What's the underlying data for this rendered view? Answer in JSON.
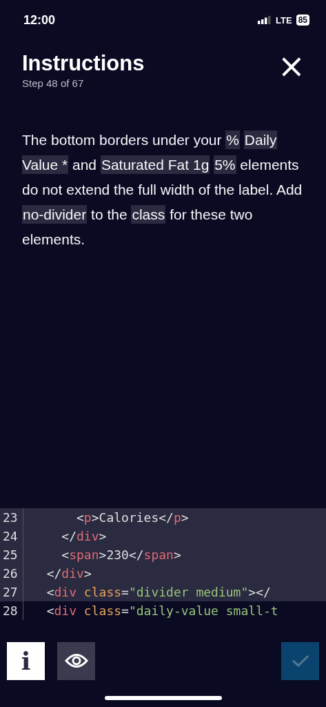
{
  "status_bar": {
    "time": "12:00",
    "network": "LTE",
    "battery": "85"
  },
  "header": {
    "title": "Instructions",
    "subtitle": "Step 48 of 67",
    "close": "×"
  },
  "instruction": [
    {
      "kind": "text",
      "text": "The bottom borders under your "
    },
    {
      "kind": "code",
      "text": "%"
    },
    {
      "kind": "code",
      "text": "Daily Value *"
    },
    {
      "kind": "text",
      "text": " and "
    },
    {
      "kind": "code",
      "text": "Saturated Fat 1g"
    },
    {
      "kind": "code",
      "text": "5%"
    },
    {
      "kind": "text",
      "text": " elements do not extend the full width of the label. Add "
    },
    {
      "kind": "code",
      "text": "no-divider"
    },
    {
      "kind": "text",
      "text": " to the "
    },
    {
      "kind": "code",
      "text": "class"
    },
    {
      "kind": "text",
      "text": " for these two elements."
    }
  ],
  "editor": {
    "lines": [
      {
        "number": "23",
        "selected": true,
        "tokens": [
          {
            "kind": "plain",
            "text": "      <"
          },
          {
            "kind": "tag",
            "text": "p"
          },
          {
            "kind": "plain",
            "text": ">Calories</"
          },
          {
            "kind": "tag",
            "text": "p"
          },
          {
            "kind": "plain",
            "text": ">"
          }
        ]
      },
      {
        "number": "24",
        "selected": true,
        "tokens": [
          {
            "kind": "plain",
            "text": "    </"
          },
          {
            "kind": "tag",
            "text": "div"
          },
          {
            "kind": "plain",
            "text": ">"
          }
        ]
      },
      {
        "number": "25",
        "selected": true,
        "tokens": [
          {
            "kind": "plain",
            "text": "    <"
          },
          {
            "kind": "tag",
            "text": "span"
          },
          {
            "kind": "plain",
            "text": ">230</"
          },
          {
            "kind": "tag",
            "text": "span"
          },
          {
            "kind": "plain",
            "text": ">"
          }
        ]
      },
      {
        "number": "26",
        "selected": true,
        "tokens": [
          {
            "kind": "plain",
            "text": "  </"
          },
          {
            "kind": "tag",
            "text": "div"
          },
          {
            "kind": "plain",
            "text": ">"
          }
        ]
      },
      {
        "number": "27",
        "selected": true,
        "tokens": [
          {
            "kind": "plain",
            "text": "  <"
          },
          {
            "kind": "tag",
            "text": "div"
          },
          {
            "kind": "attr",
            "text": " class"
          },
          {
            "kind": "plain",
            "text": "="
          },
          {
            "kind": "string",
            "text": "\"divider medium\""
          },
          {
            "kind": "plain",
            "text": "></"
          }
        ]
      },
      {
        "number": "28",
        "selected": false,
        "tokens": [
          {
            "kind": "plain",
            "text": "  <"
          },
          {
            "kind": "tag",
            "text": "div"
          },
          {
            "kind": "attr",
            "text": " class"
          },
          {
            "kind": "plain",
            "text": "="
          },
          {
            "kind": "string",
            "text": "\"daily-value small-t"
          }
        ]
      }
    ]
  },
  "toolbar": {
    "info": "i",
    "preview_selected": false,
    "submit_disabled": true
  }
}
